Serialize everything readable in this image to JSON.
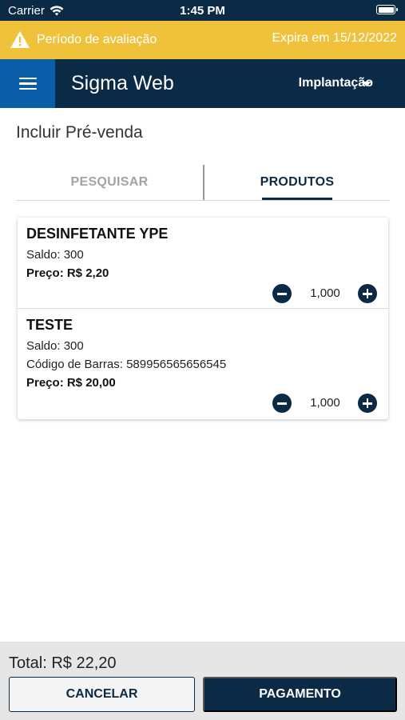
{
  "status_bar": {
    "carrier": "Carrier",
    "time": "1:45 PM",
    "icons": [
      "wifi-icon",
      "battery-icon"
    ]
  },
  "trial_banner": {
    "message": "Período de avaliação",
    "expiry": "Expira em 15/12/2022",
    "icon": "warning-icon",
    "color": "#f0c23b"
  },
  "app_bar": {
    "title": "Sigma Web",
    "company": "Implantação",
    "menu_icon": "hamburger-icon",
    "caret_icon": "caret-down-icon",
    "color": "#0b2a46",
    "menu_color": "#0a5ea8"
  },
  "page": {
    "title": "Incluir Pré-venda"
  },
  "tabs": [
    {
      "label": "PESQUISAR",
      "active": false
    },
    {
      "label": "PRODUTOS",
      "active": true
    }
  ],
  "products": [
    {
      "name": "DESINFETANTE YPE",
      "saldo": "Saldo: 300",
      "preco": "Preço: R$ 2,20",
      "quantity": "1,000"
    },
    {
      "name": "TESTE",
      "saldo": "Saldo: 300",
      "barcode": "Código de Barras: 589956565656545",
      "preco": "Preço: R$ 20,00",
      "quantity": "1,000"
    }
  ],
  "footer": {
    "total": "Total: R$ 22,20",
    "cancel_label": "CANCELAR",
    "payment_label": "PAGAMENTO"
  }
}
